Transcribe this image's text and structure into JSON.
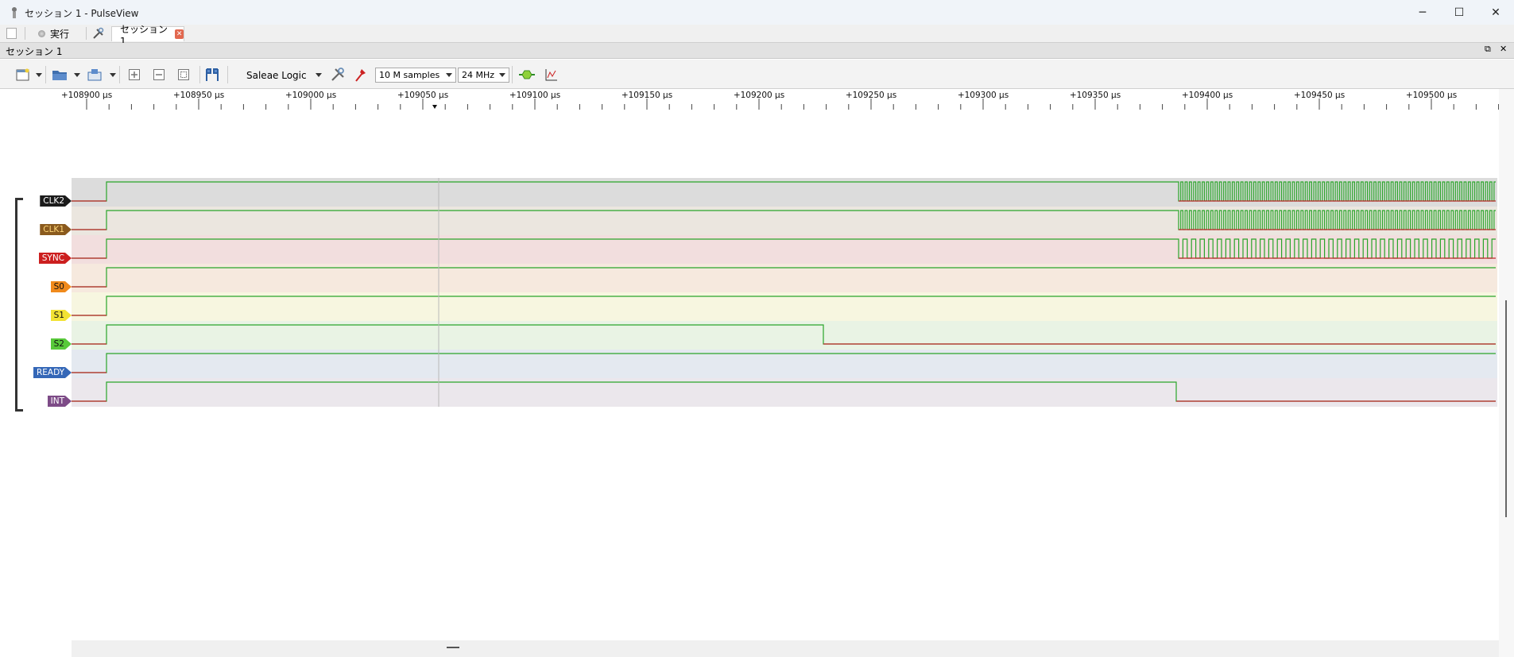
{
  "window": {
    "title": "セッション 1 - PulseView"
  },
  "tabs": {
    "run_label": "実行",
    "session_tab": "セッション 1"
  },
  "session_bar": {
    "title": "セッション 1"
  },
  "toolbar": {
    "device": "Saleae Logic",
    "samples": "10 M samples",
    "samplerate": "24 MHz"
  },
  "ruler": {
    "unit": "μs",
    "labels": [
      "+108900 μs",
      "+108950 μs",
      "+109000 μs",
      "+109050 μs",
      "+109100 μs",
      "+109150 μs",
      "+109200 μs",
      "+109250 μs",
      "+109300 μs",
      "+109350 μs",
      "+109400 μs",
      "+109450 μs",
      "+109500 μs"
    ]
  },
  "channels": [
    {
      "name": "CLK2",
      "color": "#1b1b1b",
      "text": "#ffffff",
      "bg": "#dcdcdc"
    },
    {
      "name": "CLK1",
      "color": "#8a5a1e",
      "text": "#ffd77a",
      "bg": "#ebe6df"
    },
    {
      "name": "SYNC",
      "color": "#cc1f1f",
      "text": "#ffffff",
      "bg": "#f2dede"
    },
    {
      "name": "S0",
      "color": "#f08a1c",
      "text": "#111111",
      "bg": "#f6e9de"
    },
    {
      "name": "S1",
      "color": "#f2e234",
      "text": "#111111",
      "bg": "#f7f6e0"
    },
    {
      "name": "S2",
      "color": "#58c93a",
      "text": "#111111",
      "bg": "#e9f3e4"
    },
    {
      "name": "READY",
      "color": "#3467b7",
      "text": "#ffffff",
      "bg": "#e4e9f0"
    },
    {
      "name": "INT",
      "color": "#7d4b87",
      "text": "#ffffff",
      "bg": "#ebe7ec"
    }
  ],
  "colors": {
    "high": "#2aa52a",
    "low": "#c0282c",
    "cursor": "#b9b9b9"
  }
}
